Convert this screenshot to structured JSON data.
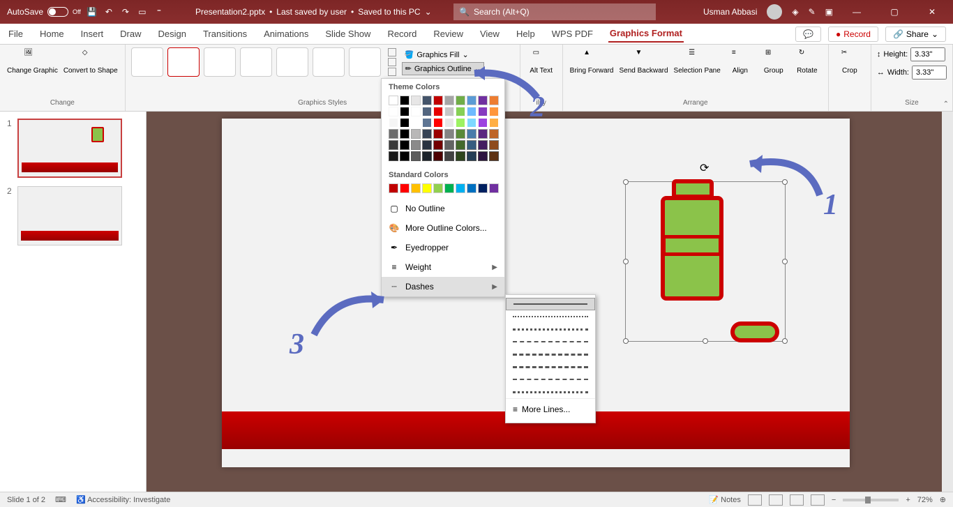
{
  "titlebar": {
    "autosave_label": "AutoSave",
    "autosave_state": "Off",
    "filename": "Presentation2.pptx",
    "save_status": "Last saved by user",
    "save_location": "Saved to this PC",
    "search_placeholder": "Search (Alt+Q)",
    "user_name": "Usman Abbasi"
  },
  "tabs": {
    "items": [
      "File",
      "Home",
      "Insert",
      "Draw",
      "Design",
      "Transitions",
      "Animations",
      "Slide Show",
      "Record",
      "Review",
      "View",
      "Help",
      "WPS PDF",
      "Graphics Format"
    ],
    "active": "Graphics Format",
    "record_btn": "Record",
    "share_btn": "Share"
  },
  "ribbon": {
    "change": {
      "change_graphic": "Change Graphic",
      "convert_shape": "Convert to Shape",
      "label": "Change"
    },
    "styles": {
      "fill_label": "Graphics Fill",
      "outline_label": "Graphics Outline",
      "label": "Graphics Styles"
    },
    "accessibility_label": "ility",
    "arrange": {
      "bring_forward": "Bring Forward",
      "send_backward": "Send Backward",
      "selection_pane": "Selection Pane",
      "align": "Align",
      "group": "Group",
      "rotate": "Rotate",
      "label": "Arrange"
    },
    "crop": {
      "label": "Crop"
    },
    "size": {
      "height_label": "Height:",
      "height_value": "3.33\"",
      "width_label": "Width:",
      "width_value": "3.33\"",
      "label": "Size"
    }
  },
  "dropdown": {
    "theme_colors": "Theme Colors",
    "standard_colors": "Standard Colors",
    "no_outline": "No Outline",
    "more_colors": "More Outline Colors...",
    "eyedropper": "Eyedropper",
    "weight": "Weight",
    "dashes": "Dashes",
    "more_lines": "More Lines...",
    "theme_palette_row1": [
      "#ffffff",
      "#000000",
      "#e7e6e6",
      "#44546a",
      "#c00000",
      "#a5a5a5",
      "#70ad47",
      "#5b9bd5",
      "#7030a0",
      "#ed7d31"
    ],
    "standard_palette": [
      "#c00000",
      "#ff0000",
      "#ffc000",
      "#ffff00",
      "#92d050",
      "#00b050",
      "#00b0f0",
      "#0070c0",
      "#002060",
      "#7030a0"
    ]
  },
  "annotations": {
    "n1": "1",
    "n2": "2",
    "n3": "3"
  },
  "statusbar": {
    "slide_info": "Slide 1 of 2",
    "accessibility": "Accessibility: Investigate",
    "notes": "Notes",
    "zoom": "72%"
  },
  "slides": {
    "s1": "1",
    "s2": "2"
  }
}
